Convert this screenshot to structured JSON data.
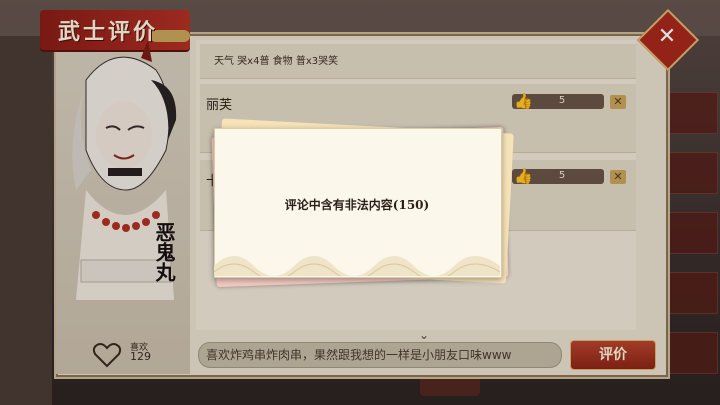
{
  "header": {
    "title": "武士评价",
    "close_icon": "close-icon"
  },
  "character": {
    "name": "恶鬼丸",
    "likes_label": "喜欢",
    "likes_count": "129"
  },
  "comments": [
    {
      "text": "天气 哭x4普 食物 普x3哭笑"
    },
    {
      "author": "丽芙",
      "likes": "5"
    },
    {
      "author": "卡",
      "likes": "5"
    }
  ],
  "input": {
    "value": "喜欢炸鸡串炸肉串，果然跟我想的一样是小朋友口味www"
  },
  "submit": {
    "label": "评价"
  },
  "modal": {
    "message": "评论中含有非法内容(150)"
  },
  "colors": {
    "accent": "#a8271c",
    "panel": "#e9e1cf",
    "modal": "#fbf7ea"
  }
}
